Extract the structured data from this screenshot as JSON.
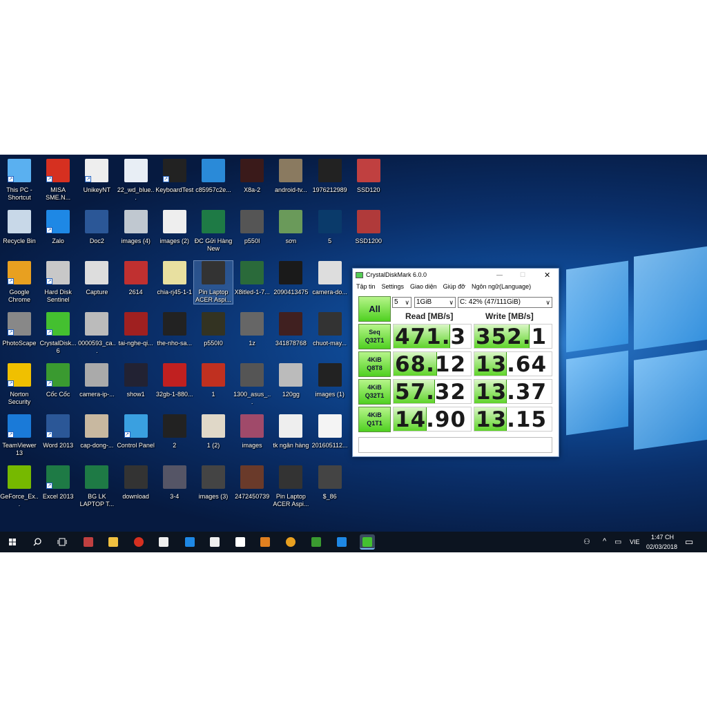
{
  "desktop": {
    "icons": [
      [
        "This PC - Shortcut",
        "#5ab0f0",
        1
      ],
      [
        "MISA SME.N...",
        "#d63020",
        1
      ],
      [
        "UnikeyNT",
        "#eee",
        1
      ],
      [
        "22_wd_blue...",
        "#e8eef5",
        0
      ],
      [
        "KeyboardTest",
        "#222",
        1
      ],
      [
        "c85957c2e...",
        "#2a8ad8",
        0
      ],
      [
        "X8a-2",
        "#3a1a1a",
        0
      ],
      [
        "android-tv...",
        "#8a7a60",
        0
      ],
      [
        "1976212989",
        "#222",
        0
      ],
      [
        "SSD120",
        "#c04040",
        0
      ],
      [
        "Recycle Bin",
        "#c8d8e8",
        0
      ],
      [
        "Zalo",
        "#1e88e5",
        1
      ],
      [
        "Doc2",
        "#2b5797",
        0
      ],
      [
        "images (4)",
        "#c0c8d0",
        0
      ],
      [
        "images (2)",
        "#eee",
        0
      ],
      [
        "ĐC Gửi Hàng New",
        "#1e7a45",
        0
      ],
      [
        "p550I",
        "#555",
        0
      ],
      [
        "sơn",
        "#6a9a5a",
        0
      ],
      [
        "5",
        "#0a3a6a",
        0
      ],
      [
        "SSD1200",
        "#b03a3a",
        0
      ],
      [
        "Google Chrome",
        "#e8a020",
        1
      ],
      [
        "Hard Disk Sentinel",
        "#c8c8c8",
        1
      ],
      [
        "Capture",
        "#ddd",
        0
      ],
      [
        "2614",
        "#c03030",
        0
      ],
      [
        "chia-rj45-1-1",
        "#e8e0a0",
        0
      ],
      [
        "Pin Laptop ACER Aspi...",
        "#333",
        0
      ],
      [
        "X8itled-1-7...",
        "#2a6a3a",
        0
      ],
      [
        "2090413475",
        "#1a1a1a",
        0
      ],
      [
        "camera-do...",
        "#ddd",
        0
      ],
      [
        "PhotoScape",
        "#888",
        1
      ],
      [
        "CrystalDisk... 6",
        "#44c030",
        1
      ],
      [
        "0000593_ca...",
        "#bbb",
        0
      ],
      [
        "tai-nghe-qi...",
        "#a02020",
        0
      ],
      [
        "the-nho-sa...",
        "#222",
        0
      ],
      [
        "p550I0",
        "#332",
        0
      ],
      [
        "1z",
        "#666",
        0
      ],
      [
        "341878768",
        "#402020",
        0
      ],
      [
        "chuot-may...",
        "#333",
        0
      ],
      [
        "Norton Security",
        "#f0c000",
        1
      ],
      [
        "Cốc Cốc",
        "#3a9a30",
        1
      ],
      [
        "camera-ip-...",
        "#aaa",
        0
      ],
      [
        "show1",
        "#223",
        0
      ],
      [
        "32gb-1-880...",
        "#c02020",
        0
      ],
      [
        "1",
        "#c03020",
        0
      ],
      [
        "1300_asus_...",
        "#555",
        0
      ],
      [
        "120gg",
        "#bbb",
        0
      ],
      [
        "images (1)",
        "#222",
        0
      ],
      [
        "TeamViewer 13",
        "#1a7ad8",
        1
      ],
      [
        "Word 2013",
        "#2b5797",
        1
      ],
      [
        "cap-dong-...",
        "#c8b8a0",
        0
      ],
      [
        "Control Panel",
        "#3aa0e0",
        1
      ],
      [
        "2",
        "#222",
        0
      ],
      [
        "1 (2)",
        "#e0d8c8",
        0
      ],
      [
        "images",
        "#a04a6a",
        0
      ],
      [
        "tk ngân hàng",
        "#eee",
        0
      ],
      [
        "201605112...",
        "#f4f4f4",
        0
      ],
      [
        "GeForce_Ex...",
        "#76b900",
        0
      ],
      [
        "Excel 2013",
        "#1e7a45",
        1
      ],
      [
        "BG LK LAPTOP T...",
        "#1e7a45",
        0
      ],
      [
        "download",
        "#333",
        0
      ],
      [
        "3-4",
        "#556",
        0
      ],
      [
        "images (3)",
        "#444",
        0
      ],
      [
        "2472450739",
        "#6a3a2a",
        0
      ],
      [
        "Pin Laptop ACER Aspi...",
        "#333",
        0
      ],
      [
        "$_86",
        "#444",
        0
      ]
    ],
    "icon_rows": [
      10,
      10,
      9,
      9,
      9,
      9,
      9
    ]
  },
  "cdm": {
    "title": "CrystalDiskMark 6.0.0",
    "menu": [
      "Tập tin",
      "Settings",
      "Giao diện",
      "Giúp đỡ",
      "Ngôn ngữ(Language)"
    ],
    "all_label": "All",
    "count": "5",
    "size": "1GiB",
    "drive": "C: 42% (47/111GiB)",
    "read_header": "Read [MB/s]",
    "write_header": "Write [MB/s]",
    "tests": [
      {
        "label1": "Seq",
        "label2": "Q32T1",
        "read": "471.3",
        "write": "352.1",
        "read_fill": 0.73,
        "write_fill": 0.71
      },
      {
        "label1": "4KiB",
        "label2": "Q8T8",
        "read": "68.12",
        "write": "13.64",
        "read_fill": 0.56,
        "write_fill": 0.42
      },
      {
        "label1": "4KiB",
        "label2": "Q32T1",
        "read": "57.32",
        "write": "13.37",
        "read_fill": 0.54,
        "write_fill": 0.42
      },
      {
        "label1": "4KiB",
        "label2": "Q1T1",
        "read": "14.90",
        "write": "13.15",
        "read_fill": 0.43,
        "write_fill": 0.42
      }
    ],
    "comment": "",
    "minimize": "—",
    "maximize": "☐",
    "close": "✕"
  },
  "taskbar": {
    "apps": [
      "paint",
      "file-explorer",
      "misa",
      "unikey",
      "edge",
      "store",
      "mail",
      "media",
      "chrome",
      "coccoc",
      "zalo",
      "crystaldiskmark"
    ],
    "app_colors": [
      "#c04040",
      "#f0c040",
      "#d63020",
      "#eee",
      "#1e88e5",
      "#eee",
      "#fff",
      "#e08020",
      "#e8a020",
      "#3a9a30",
      "#1e88e5",
      "#44c030"
    ],
    "lang": "VIE",
    "time": "1:47 CH",
    "date": "02/03/2018"
  }
}
